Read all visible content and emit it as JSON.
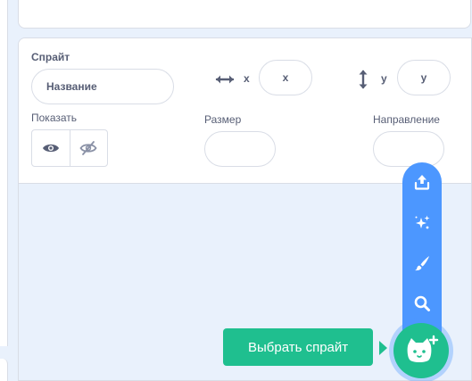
{
  "sprite_info": {
    "sprite_label": "Спрайт",
    "name_placeholder": "Название",
    "x_label": "x",
    "x_placeholder": "x",
    "y_label": "y",
    "y_placeholder": "y",
    "show_label": "Показать",
    "size_label": "Размер",
    "size_value": "",
    "direction_label": "Направление",
    "direction_value": ""
  },
  "sprite_menu": {
    "items": [
      "upload-icon",
      "surprise-icon",
      "paint-icon",
      "search-icon"
    ],
    "main_button_icon": "cat-plus-icon",
    "tooltip": "Выбрать спрайт"
  },
  "colors": {
    "accent_blue": "#4c97ff",
    "accent_green": "#1fbf8f",
    "panel_bg": "#e9f1fc",
    "text": "#575e75"
  }
}
